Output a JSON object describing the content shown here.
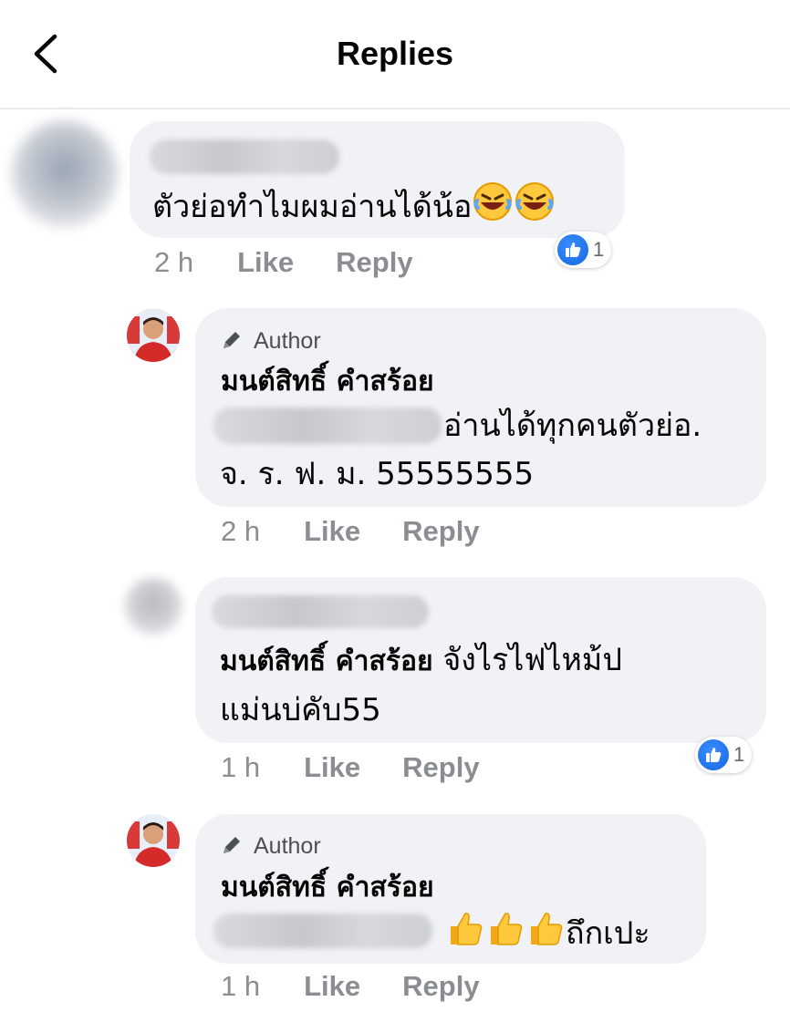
{
  "header": {
    "title": "Replies"
  },
  "comments": [
    {
      "text": "ตัวย่อทำไมผมอ่านได้น้อ",
      "emoji": "rolling-laughing-emoji ×2",
      "time": "2 h",
      "like": "Like",
      "reply": "Reply",
      "reactions": {
        "type": "like",
        "count": "1"
      }
    },
    {
      "badge": "Author",
      "name": "มนต์สิทธิ์ คำสร้อย",
      "line1": "อ่านได้ทุกคนตัวย่อ.",
      "line2": "จ. ร. ฟ. ม.  55555555",
      "time": "2 h",
      "like": "Like",
      "reply": "Reply"
    },
    {
      "mention": "มนต์สิทธิ์ คำสร้อย",
      "line1": " จังไรไฟไหม้ป",
      "line2": "แม่นบ่คับ55",
      "time": "1 h",
      "like": "Like",
      "reply": "Reply",
      "reactions": {
        "type": "like",
        "count": "1"
      }
    },
    {
      "badge": "Author",
      "name": "มนต์สิทธิ์ คำสร้อย",
      "emoji": "thumbs-up-emoji ×3",
      "text": "ถึกเปะ",
      "time": "1 h",
      "like": "Like",
      "reply": "Reply"
    }
  ],
  "colors": {
    "bubble": "#f0f2f5",
    "meta": "#8a8d91",
    "like_blue": "#1877f2"
  }
}
